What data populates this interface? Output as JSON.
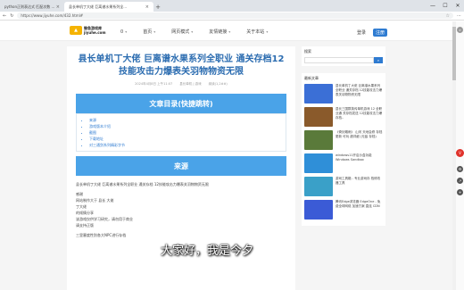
{
  "browser": {
    "tabs": [
      {
        "label": "python正则表达式 匹配次数 ..."
      },
      {
        "label": "县长单机丁大佬 巨离谱水果系列全..."
      }
    ],
    "url": "https://www.jiyuhe.com/432.html#",
    "controls": {
      "minimize": "—",
      "maximize": "☐",
      "close": "✕"
    }
  },
  "header": {
    "logo_line1": "鲸鱼游戏库",
    "logo_line2": "jiyuhe.com",
    "menu": [
      {
        "label": "0"
      },
      {
        "label": "首页"
      },
      {
        "label": "网页模式"
      },
      {
        "label": "友情链接"
      },
      {
        "label": "关于本站"
      }
    ],
    "login": "登录",
    "register": "注册"
  },
  "article": {
    "title": "县长单机丁大佬 巨离谱水果系列全职业 通关存档12技能攻击力爆表关羽物物资无限",
    "meta": [
      "2024年4月8日 上午11:07",
      "县长单机 | 游戏",
      "阅读(1,2##)"
    ],
    "toc_heading": "文章目录(快捷跳转)",
    "toc": [
      "来源",
      "游戏版本介绍",
      "截图",
      "下载地址",
      "对三通剑系列精彩字节"
    ],
    "section_heading": "来源",
    "paragraphs": [
      "县长单机丁大佬 巨离谱水果系列全职业 通关存档 12技能攻击力爆表关羽物物资无限",
      "感谢",
      "网站制作大于 县长 大佬",
      "丁大佬",
      "的倾情分享",
      "该游戏仅供学习研究，请勿用于商业",
      "请支持正版",
      "三里塞度性别各大NPC进行存档"
    ]
  },
  "sidebar": {
    "search_title": "搜索",
    "search_placeholder": "",
    "recommend_title": "最新文章",
    "items": [
      {
        "text": "县长单机丁大佬 巨离谱水果系列全职业 通关存档 12技能攻击力爆表关羽物物资无限",
        "color": "#3b6fd6"
      },
      {
        "text": "县长三国群英传单机游戏 12 全职业通 关存档发送 12技能攻击力爆 存档..",
        "color": "#8a5a2b"
      },
      {
        "text": "《倚剑烟雨》 山河 天地会修 存档 更新 可玩 超详细 (无敌 存档)",
        "color": "#5a7a3a"
      },
      {
        "text": "windows11开启沙盒功能 Windows Sandbox",
        "color": "#2f8fd8"
      },
      {
        "text": "游戏工具箱 - 专业游戏存 档修改器工具",
        "color": "#3aa0c8"
      },
      {
        "text": "腾讯Edge浏览器 EdgeOne - 免费全球网络 加速方案 直连 CDN",
        "color": "#3b5bd6"
      }
    ]
  },
  "subtitle": "大家好，我是今夕"
}
